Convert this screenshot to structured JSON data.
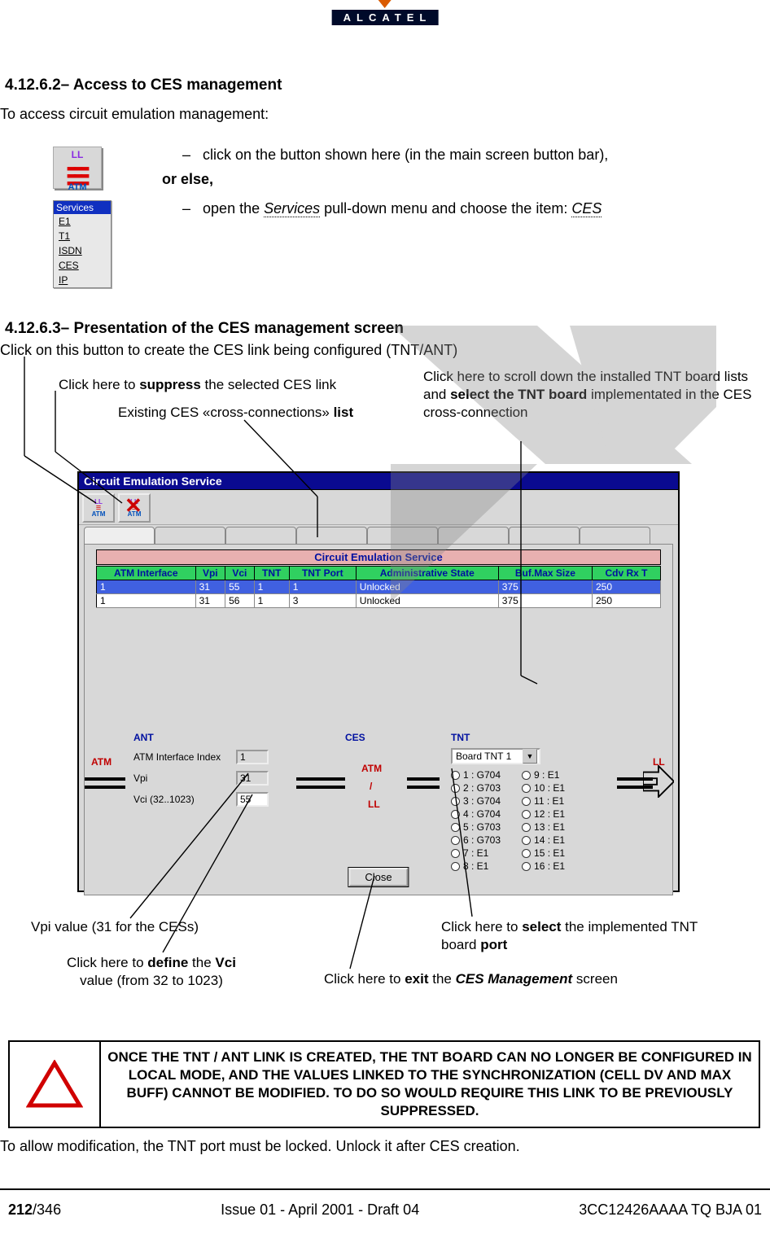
{
  "logo_text": "ALCATEL",
  "section1": {
    "number": "4.12.6.2–",
    "title": "Access to CES management",
    "intro": "To access circuit emulation management:",
    "bullet1_dash": "–",
    "bullet1": "click on the button shown here (in the main screen button bar),",
    "orelse": "or else,",
    "bullet2_dash": "–",
    "bullet2_pre": "open the ",
    "bullet2_services": "Services",
    "bullet2_mid": " pull-down menu and choose the item: ",
    "bullet2_ces": "CES"
  },
  "llatm": {
    "ll": "LL",
    "atm": "ATM"
  },
  "services_menu": {
    "head": "Services",
    "items": [
      "E1",
      "T1",
      "ISDN",
      "CES",
      "IP"
    ]
  },
  "section2": {
    "number": "4.12.6.3–",
    "title": "Presentation of the CES management screen",
    "line1": "Click on this button to create the CES link being configured (TNT/ANT)"
  },
  "annos": {
    "suppress_pre": "Click here to ",
    "suppress_b": "suppress",
    "suppress_post": " the selected CES link",
    "existing_pre": "Existing CES «cross-connections» ",
    "existing_b": "list",
    "scroll_pre": "Click here to scroll down the installed TNT board lists and ",
    "scroll_b": "select the TNT board",
    "scroll_post": " implementated in the CES cross-connection",
    "vpi": "Vpi value (31 for the CESs)",
    "vci_pre": "Click here to ",
    "vci_b1": "define",
    "vci_mid": " the  ",
    "vci_b2": "Vci",
    "vci_post": " value (from 32 to 1023)",
    "port_pre": "Click here to ",
    "port_b1": "select",
    "port_mid": " the implemented TNT board ",
    "port_b2": "port",
    "exit_pre": "Click here to ",
    "exit_b": "exit",
    "exit_mid": " the ",
    "exit_i": "CES Management",
    "exit_post": " screen"
  },
  "ces_window": {
    "title": "Circuit Emulation Service",
    "table_title": "Circuit Emulation Service",
    "columns": [
      "ATM Interface",
      "Vpi",
      "Vci",
      "TNT",
      "TNT Port",
      "Administrative State",
      "Buf.Max Size",
      "Cdv Rx T"
    ],
    "rows": [
      {
        "atm": "1",
        "vpi": "31",
        "vci": "55",
        "tnt": "1",
        "tntport": "1",
        "admin": "Unlocked",
        "buf": "375",
        "cdv": "250"
      },
      {
        "atm": "1",
        "vpi": "31",
        "vci": "56",
        "tnt": "1",
        "tntport": "3",
        "admin": "Unlocked",
        "buf": "375",
        "cdv": "250"
      }
    ],
    "labels": {
      "atm_side": "ATM",
      "ant": "ANT",
      "ces": "CES",
      "tnt": "TNT",
      "ll_side": "LL",
      "atm_over_ll_top": "ATM",
      "slash": "/",
      "atm_over_ll_bot": "LL",
      "atm_if": "ATM Interface Index",
      "vpi": "Vpi",
      "vci": "Vci (32..1023)"
    },
    "fields": {
      "atm_if": "1",
      "vpi": "31",
      "vci": "55"
    },
    "dropdown": "Board TNT 1",
    "radios_left": [
      "1 : G704",
      "2 : G703",
      "3 : G704",
      "4 : G704",
      "5 : G703",
      "6 : G703",
      "7 : E1",
      "8 : E1"
    ],
    "radios_right": [
      "9 : E1",
      "10 : E1",
      "11 : E1",
      "12 : E1",
      "13 : E1",
      "14 : E1",
      "15 : E1",
      "16 : E1"
    ],
    "close": "Close"
  },
  "warning": "ONCE THE TNT / ANT LINK IS CREATED, THE TNT BOARD CAN NO LONGER BE CONFIGURED IN LOCAL MODE, AND THE VALUES LINKED TO THE SYNCHRONIZATION (CELL DV AND MAX BUFF) CANNOT BE MODIFIED. TO DO SO WOULD REQUIRE THIS LINK TO BE PREVIOUSLY SUPPRESSED.",
  "after_warn": "To allow modification, the TNT port must be locked. Unlock it after CES creation.",
  "footer": {
    "page_bold": "212",
    "page_total": "/346",
    "center": "Issue 01 - April 2001 - Draft 04",
    "right": "3CC12426AAAA TQ BJA 01"
  }
}
